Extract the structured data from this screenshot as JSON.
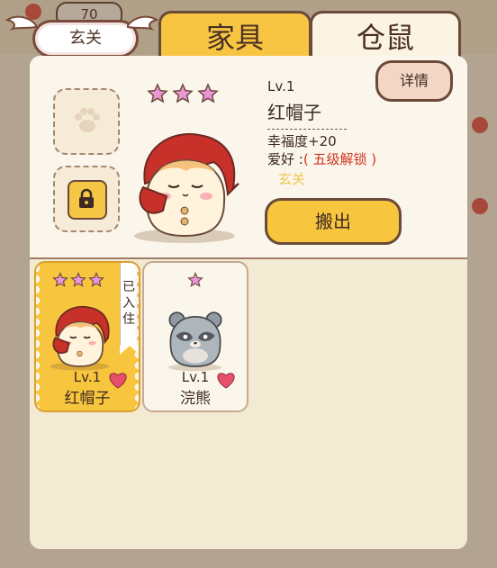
{
  "background": {
    "counter_value": "70"
  },
  "location_badge": {
    "label": "玄关"
  },
  "tabs": [
    {
      "label": "家具",
      "active": false
    },
    {
      "label": "仓鼠",
      "active": true
    }
  ],
  "selected_hamster": {
    "stars": 3,
    "level": "Lv.1",
    "name": "红帽子",
    "happiness": "幸福度+20",
    "hobby_label": "爱好 :",
    "hobby_value": "( 五级解锁 )",
    "location": "玄关",
    "detail_button": "详情",
    "moveout_button": "搬出"
  },
  "cards": [
    {
      "name": "红帽子",
      "level": "Lv.1",
      "stars": 3,
      "tag": "已入住",
      "tag_chars": [
        "已",
        "入",
        "住"
      ],
      "selected": true
    },
    {
      "name": "浣熊",
      "level": "Lv.1",
      "stars": 1,
      "selected": false
    }
  ],
  "colors": {
    "accent_yellow": "#f8c53e",
    "panel": "#f3ead3",
    "outline": "#6b4a3a",
    "star": "#e996d6",
    "hobby_red": "#d0321f",
    "location_gold": "#f1c64a",
    "heart": "#e8506a"
  },
  "icons": {
    "paw": "paw-icon",
    "lock": "lock-icon",
    "star": "star-icon",
    "heart": "heart-icon"
  }
}
